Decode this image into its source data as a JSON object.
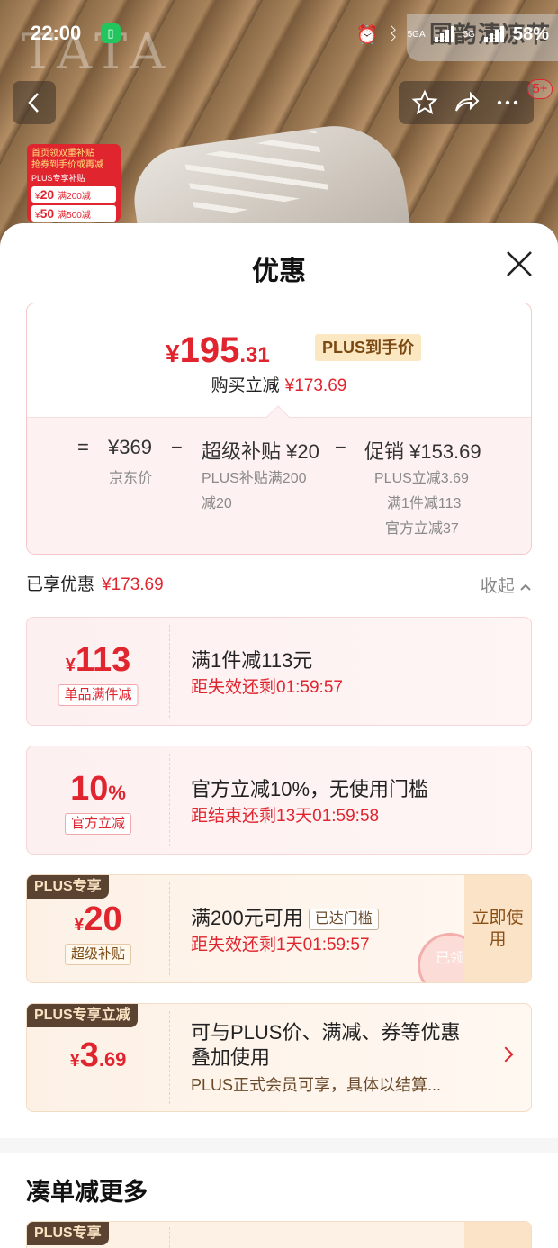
{
  "status_bar": {
    "time": "22:00",
    "battery": "58%",
    "network_label_1": "5GA",
    "network_label_2": "5G",
    "overlay_text": "国韵清凉节"
  },
  "backdrop": {
    "brand_watermark": "TATA",
    "promo_tag": {
      "line1": "首页领双重补贴",
      "line2": "抢券到手价或再减",
      "header": "PLUS专享补贴",
      "rows": [
        {
          "amount": "20",
          "text": "满200减"
        },
        {
          "amount": "50",
          "text": "满500减"
        }
      ]
    },
    "nav_badge": "5+"
  },
  "sheet": {
    "title": "优惠",
    "summary": {
      "yen": "¥",
      "price_int": "195",
      "price_dec": ".31",
      "plus_chip": "PLUS到手价",
      "sub_label": "购买立减",
      "sub_amount": "¥173.69",
      "calc": {
        "eq": "=",
        "jd_price": "¥369",
        "minus1": "−",
        "subsidy": "超级补贴 ¥20",
        "minus2": "−",
        "promo": "促销 ¥153.69",
        "jd_price_note": "京东价",
        "subsidy_note_1": "PLUS补贴满200",
        "subsidy_note_2": "减20",
        "promo_note_1": "PLUS立减3.69",
        "promo_note_2": "满1件减113",
        "promo_note_3": "官方立减37"
      }
    },
    "enjoyed": {
      "label": "已享优惠",
      "amount": "¥173.69",
      "collapse": "收起"
    },
    "coupons": [
      {
        "yen": "¥",
        "amount": "113",
        "label": "单品满件减",
        "title": "满1件减113元",
        "timer": "距失效还剩01:59:57"
      },
      {
        "amount": "10",
        "suffix": "%",
        "label": "官方立减",
        "title": "官方立减10%，无使用门槛",
        "timer": "距结束还剩13天01:59:58"
      },
      {
        "badge": "PLUS专享",
        "yen": "¥",
        "amount": "20",
        "label": "超级补贴",
        "title": "满200元可用",
        "reach_tag": "已达门槛",
        "timer": "距失效还剩1天01:59:57",
        "use_button": "立即使用",
        "stamp": "已领"
      },
      {
        "badge": "PLUS专享立减",
        "yen": "¥",
        "amount": "3",
        "decimal": ".69",
        "desc": "可与PLUS价、满减、券等优惠叠加使用",
        "sub_desc": "PLUS正式会员可享，具体以结算..."
      }
    ],
    "more_section": {
      "title": "凑单减更多",
      "badge": "PLUS专享"
    }
  }
}
